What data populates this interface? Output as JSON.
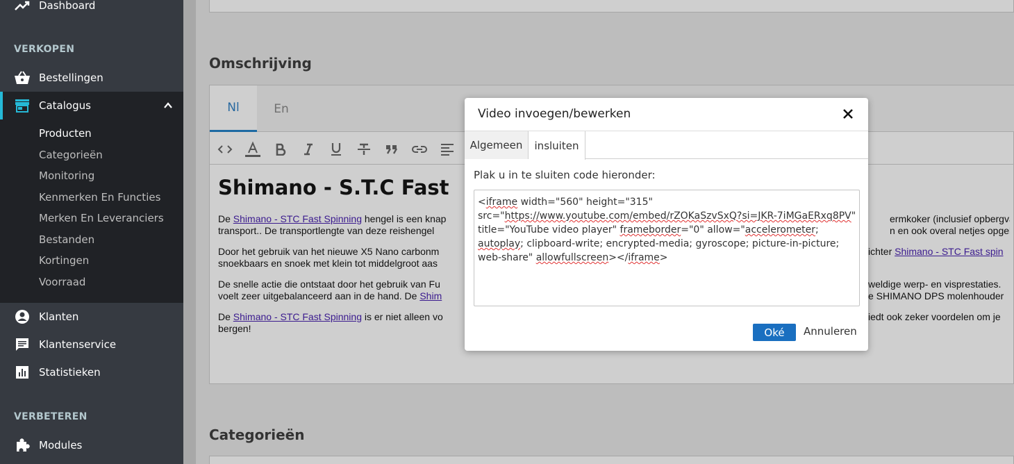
{
  "sidebar": {
    "dashboard": "Dashboard",
    "section_sell": "VERKOPEN",
    "orders": "Bestellingen",
    "catalog": "Catalogus",
    "catalog_sub": [
      "Producten",
      "Categorieën",
      "Monitoring",
      "Kenmerken En Functies",
      "Merken En Leveranciers",
      "Bestanden",
      "Kortingen",
      "Voorraad"
    ],
    "customers": "Klanten",
    "customer_service": "Klantenservice",
    "stats": "Statistieken",
    "section_improve": "VERBETEREN",
    "modules": "Modules"
  },
  "main": {
    "description_title": "Omschrijving",
    "categories_title": "Categorieën",
    "lang_tabs": [
      "Nl",
      "En"
    ],
    "toolbar_icons": [
      "code-icon",
      "text-color-icon",
      "bold-icon",
      "italic-icon",
      "underline-icon",
      "strikethrough-icon",
      "quote-icon",
      "link-icon",
      "align-icon"
    ],
    "content": {
      "heading": "Shimano - S.T.C Fast",
      "p1_pre": "De ",
      "p1_link": "Shimano - STC Fast Spinning",
      "p1_post": " hengel is een knap",
      "p1_right": "ermkoker (inclusief opbergvak",
      "p1b_left": "transport.. De transportlengte van deze reishengel",
      "p1b_right": "n en ook overal netjes opgebo",
      "p2_left": "Door het gebruik van het nieuwe X5 Nano carbonm",
      "p2_right_pre": "ichter ",
      "p2_right_link": "Shimano - STC Fast spin",
      "p2b_left": "snoekbaars en snoek met klein tot middelgroot aas",
      "p3_left": "De snelle actie die ontstaat door het gebruik van Fu",
      "p3_right": "weldige werp- en visprestaties.",
      "p3b_left_pre": "voelt zeer uitgebalanceerd aan in de hand. De ",
      "p3b_left_link": "Shim",
      "p3b_right": "e SHIMANO DPS molenhouder",
      "p4_pre": "De ",
      "p4_link": "Shimano - STC Fast Spinning",
      "p4_post": " is er niet alleen vo",
      "p4_right": "iedt ook zeker voordelen om je",
      "p4b": "bergen!"
    }
  },
  "modal": {
    "title": "Video invoegen/bewerken",
    "tab_general": "Algemeen",
    "tab_embed": "insluiten",
    "label": "Plak u in te sluiten code hieronder:",
    "ok": "Oké",
    "cancel": "Annuleren",
    "code": {
      "l1a": "<",
      "l1b": "iframe",
      "l1c": " width=\"560\" height=\"315\"",
      "l2a": "src=\"",
      "l2b": "https://www.youtube.com/embed/rZOKaSzvSxQ?si=JKR-7iMGaERxq8PV",
      "l2c": "\"",
      "l3a": "title=\"YouTube video player\" ",
      "l3b": "frameborder",
      "l3c": "=\"0\" allow=\"",
      "l3d": "accelerometer",
      "l3e": ";",
      "l4a": "autoplay",
      "l4b": "; clipboard-write; encrypted-media; gyroscope; picture-in-picture;",
      "l5a": "web-share\" ",
      "l5b": "allowfullscreen",
      "l5c": "></",
      "l5d": "iframe",
      "l5e": ">"
    }
  }
}
